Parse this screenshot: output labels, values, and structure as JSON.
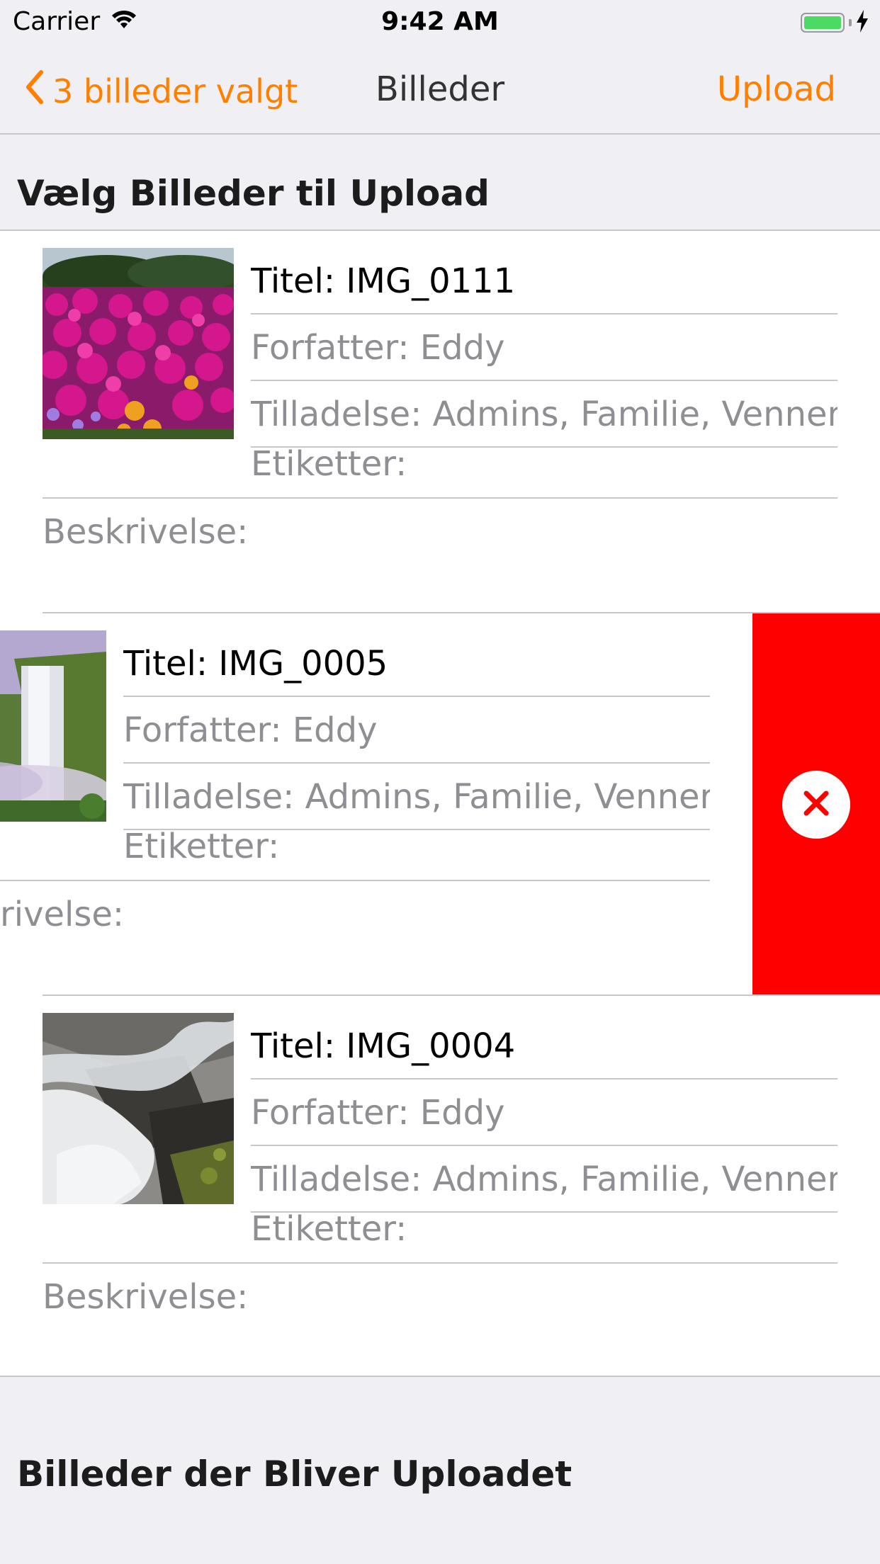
{
  "status_bar": {
    "carrier": "Carrier",
    "time": "9:42 AM",
    "battery_color": "#4cd964"
  },
  "nav": {
    "back_label": "3 billeder valgt",
    "title": "Billeder",
    "upload_label": "Upload",
    "accent_color": "#ff8000"
  },
  "sections": {
    "select_header": "Vælg Billeder til Upload",
    "uploading_header": "Billeder der Bliver Uploadet"
  },
  "images": [
    {
      "title": "Titel: IMG_0111",
      "author": "Forfatter: Eddy",
      "permission": "Tilladelse: Admins, Familie, Venner",
      "tags": "Etiketter:",
      "description": "Beskrivelse:",
      "thumbnail": "pink-flowers"
    },
    {
      "title": "Titel: IMG_0005",
      "author": "Forfatter: Eddy",
      "permission": "Tilladelse: Admins, Familie, Venner",
      "tags": "Etiketter:",
      "description": "rivelse:",
      "thumbnail": "waterfall",
      "swiped_to_delete": true
    },
    {
      "title": "Titel: IMG_0004",
      "author": "Forfatter: Eddy",
      "permission": "Tilladelse: Admins, Familie, Venner",
      "tags": "Etiketter:",
      "description": "Beskrivelse:",
      "thumbnail": "stream-rocks"
    }
  ],
  "delete_action": {
    "icon": "close-icon",
    "color": "#ff0000"
  }
}
